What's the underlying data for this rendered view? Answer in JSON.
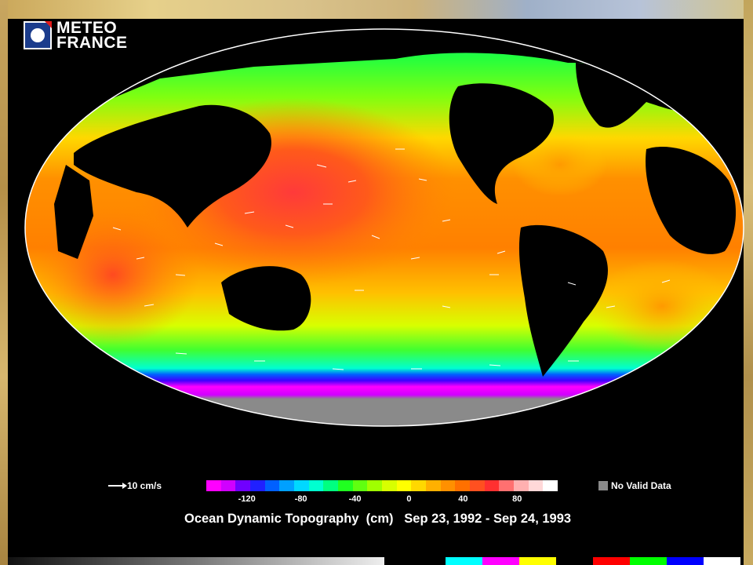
{
  "logo": {
    "line1": "METEO",
    "line2": "FRANCE"
  },
  "legend": {
    "vector_label": "10 cm/s",
    "ticks": [
      "-120",
      "-80",
      "-40",
      "0",
      "40",
      "80"
    ],
    "no_data_label": "No Valid Data",
    "no_data_color": "#8a8a8a"
  },
  "caption": {
    "title": "Ocean Dynamic Topography  (cm)",
    "period": "Sep 23, 1992 - Sep 24, 1993"
  },
  "colorscale": [
    "#ff00ff",
    "#d000ff",
    "#7000ff",
    "#2020ff",
    "#0060ff",
    "#00a0ff",
    "#00d8ff",
    "#00ffd0",
    "#00ff80",
    "#20ff20",
    "#60ff10",
    "#a0ff00",
    "#d8ff00",
    "#ffff00",
    "#ffd800",
    "#ffb000",
    "#ff9000",
    "#ff7000",
    "#ff5020",
    "#ff3030",
    "#ff7070",
    "#ffb0b0",
    "#ffd8d8",
    "#ffffff"
  ],
  "colorscale_range": [
    -150,
    110
  ],
  "bottom_chips": [
    "#00ffff",
    "#ff00ff",
    "#ffff00",
    "#000000",
    "#ff0000",
    "#00ff00",
    "#0000ff",
    "#ffffff"
  ]
}
